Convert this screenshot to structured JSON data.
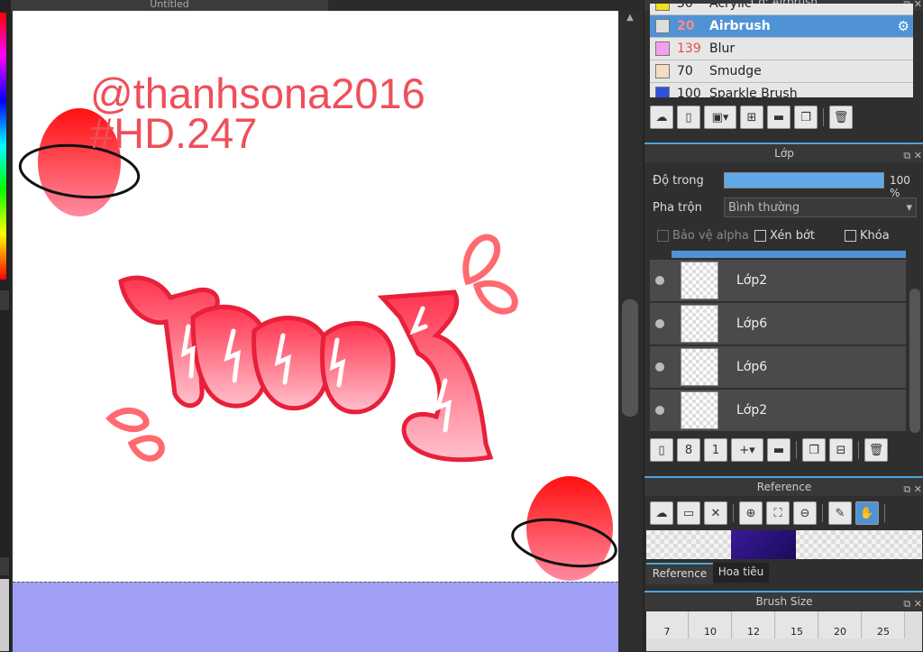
{
  "document": {
    "tab_title": "Untitled"
  },
  "artwork": {
    "watermark_line1": "@thanhsona2016",
    "watermark_line2": "#HD.247"
  },
  "brush_panel": {
    "title": "Cọ: Airbrush",
    "items": [
      {
        "size": "50",
        "name": "Acrylic",
        "color": "#f0e020"
      },
      {
        "size": "20",
        "name": "Airbrush",
        "color": "#dddddd",
        "selected": true
      },
      {
        "size": "139",
        "name": "Blur",
        "color": "#f4a0f0"
      },
      {
        "size": "70",
        "name": "Smudge",
        "color": "#f6dcc2"
      },
      {
        "size": "100",
        "name": "Sparkle Brush",
        "color": "#3050e0"
      }
    ]
  },
  "layer_panel": {
    "title": "Lớp",
    "opacity_label": "Độ trong",
    "opacity_value": "100 %",
    "opacity_fraction": 1.0,
    "blend_label": "Pha trộn",
    "blend_value": "Bình thường",
    "protect_alpha": "Bảo vệ alpha",
    "clipping": "Xén bớt",
    "lock": "Khóa",
    "layers": [
      {
        "name": "Lớp2"
      },
      {
        "name": "Lớp6"
      },
      {
        "name": "Lớp6"
      },
      {
        "name": "Lớp2"
      }
    ]
  },
  "reference_panel": {
    "title": "Reference",
    "tabs": [
      "Reference",
      "Hoa tiêu"
    ]
  },
  "brush_size_panel": {
    "title": "Brush Size",
    "sizes": [
      "7",
      "10",
      "12",
      "15",
      "20",
      "25"
    ]
  },
  "colors": {
    "accent": "#4f93d6",
    "canvas_bg": "#a09ff6",
    "art_red": "#ef4f5a"
  }
}
